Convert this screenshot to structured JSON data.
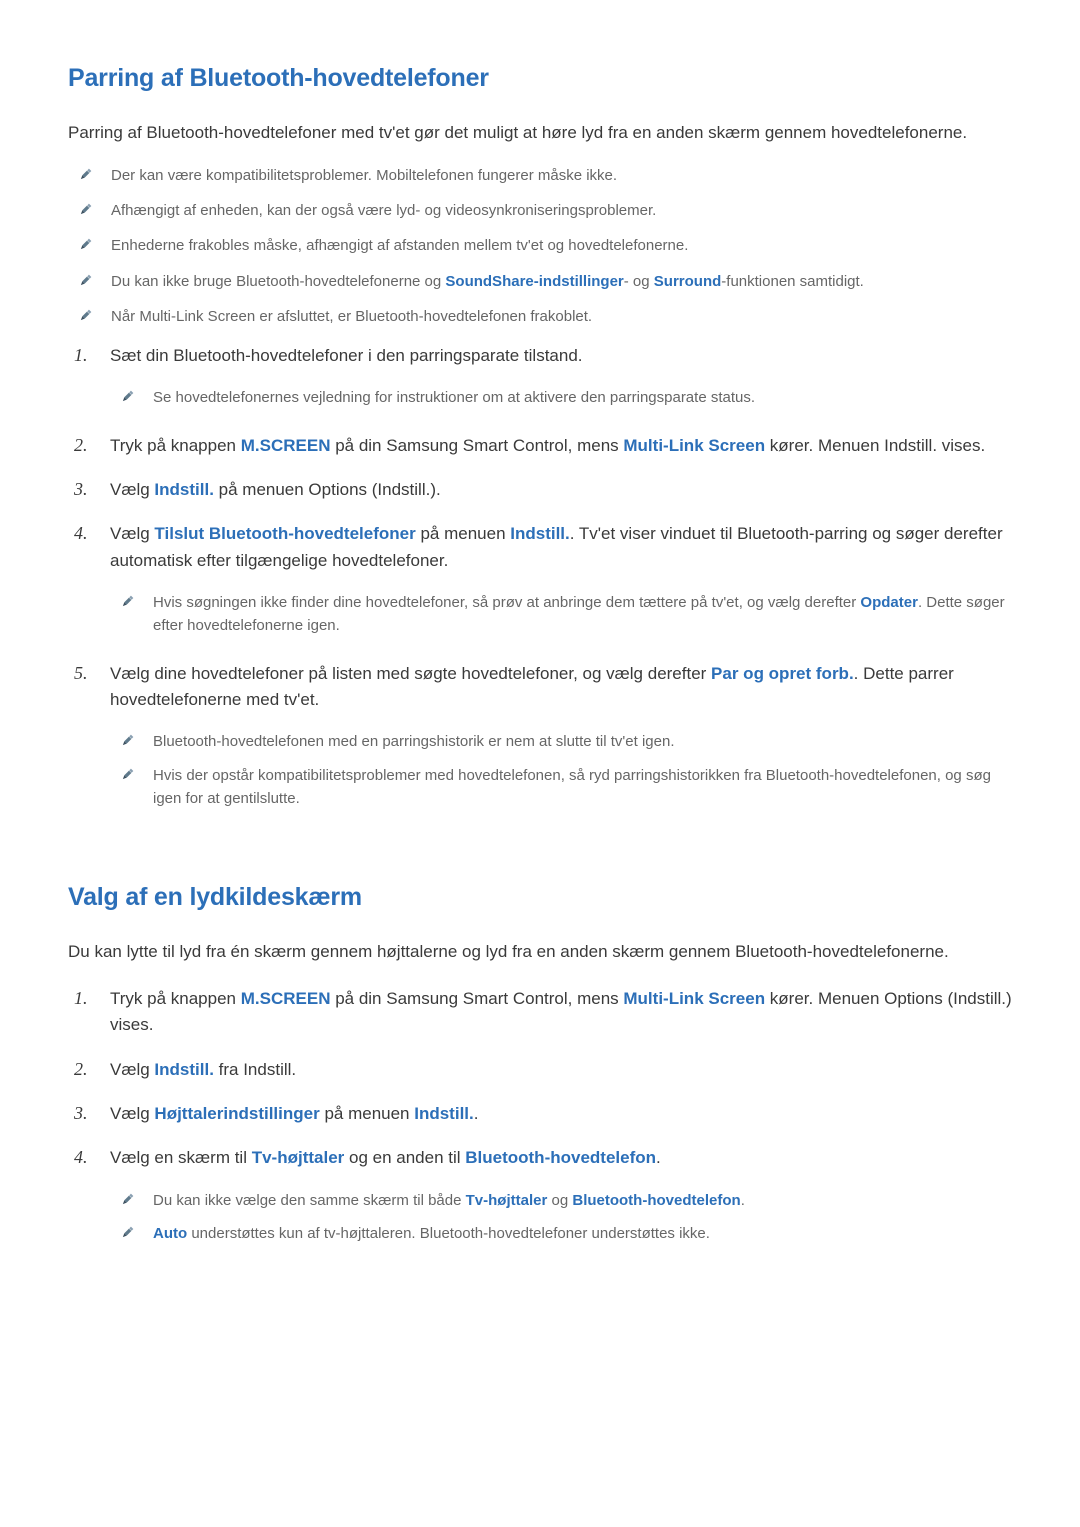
{
  "section1": {
    "title": "Parring af Bluetooth-hovedtelefoner",
    "intro": "Parring af Bluetooth-hovedtelefoner med tv'et gør det muligt at høre lyd fra en anden skærm gennem hovedtelefonerne.",
    "notes": [
      {
        "text": "Der kan være kompatibilitetsproblemer. Mobiltelefonen fungerer måske ikke."
      },
      {
        "text": "Afhængigt af enheden, kan der også være lyd- og videosynkroniseringsproblemer."
      },
      {
        "text": "Enhederne frakobles måske, afhængigt af afstanden mellem tv'et og hovedtelefonerne."
      },
      {
        "pre": "Du kan ikke bruge Bluetooth-hovedtelefonerne og ",
        "kw1": "SoundShare-indstillinger",
        "mid": "- og ",
        "kw2": "Surround",
        "post": "-funktionen samtidigt."
      },
      {
        "text": "Når Multi-Link Screen er afsluttet, er Bluetooth-hovedtelefonen frakoblet."
      }
    ],
    "steps": [
      {
        "num": "1.",
        "text": "Sæt din Bluetooth-hovedtelefoner i den parringsparate tilstand.",
        "subnotes": [
          {
            "text": "Se hovedtelefonernes vejledning for instruktioner om at aktivere den parringsparate status."
          }
        ]
      },
      {
        "num": "2.",
        "pre": "Tryk på knappen ",
        "kw1": "M.SCREEN",
        "mid": " på din Samsung Smart Control, mens ",
        "kw2": "Multi-Link Screen",
        "post": " kører. Menuen Indstill. vises."
      },
      {
        "num": "3.",
        "pre": "Vælg ",
        "kw1": "Indstill.",
        "post": " på menuen Options (Indstill.)."
      },
      {
        "num": "4.",
        "pre": "Vælg ",
        "kw1": "Tilslut Bluetooth-hovedtelefoner",
        "mid": " på menuen ",
        "kw2": "Indstill.",
        "post": ". Tv'et viser vinduet til Bluetooth-parring og søger derefter automatisk efter tilgængelige hovedtelefoner.",
        "subnotes": [
          {
            "pre": "Hvis søgningen ikke finder dine hovedtelefoner, så prøv at anbringe dem tættere på tv'et, og vælg derefter ",
            "kw1": "Opdater",
            "post": ". Dette søger efter hovedtelefonerne igen."
          }
        ]
      },
      {
        "num": "5.",
        "pre": "Vælg dine hovedtelefoner på listen med søgte hovedtelefoner, og vælg derefter ",
        "kw1": "Par og opret forb.",
        "post": ". Dette parrer hovedtelefonerne med tv'et.",
        "subnotes": [
          {
            "text": "Bluetooth-hovedtelefonen med en parringshistorik er nem at slutte til tv'et igen."
          },
          {
            "text": "Hvis der opstår kompatibilitetsproblemer med hovedtelefonen, så ryd parringshistorikken fra Bluetooth-hovedtelefonen, og søg igen for at gentilslutte."
          }
        ]
      }
    ]
  },
  "section2": {
    "title": "Valg af en lydkildeskærm",
    "intro": "Du kan lytte til lyd fra én skærm gennem højttalerne og lyd fra en anden skærm gennem Bluetooth-hovedtelefonerne.",
    "steps": [
      {
        "num": "1.",
        "pre": "Tryk på knappen ",
        "kw1": "M.SCREEN",
        "mid": " på din Samsung Smart Control, mens ",
        "kw2": "Multi-Link Screen",
        "post": " kører. Menuen Options (Indstill.) vises."
      },
      {
        "num": "2.",
        "pre": "Vælg ",
        "kw1": "Indstill.",
        "post": " fra Indstill."
      },
      {
        "num": "3.",
        "pre": "Vælg ",
        "kw1": "Højttalerindstillinger",
        "mid": " på menuen ",
        "kw2": "Indstill.",
        "post": "."
      },
      {
        "num": "4.",
        "pre": "Vælg en skærm til ",
        "kw1": "Tv-højttaler",
        "mid": " og en anden til ",
        "kw2": "Bluetooth-hovedtelefon",
        "post": ".",
        "subnotes": [
          {
            "pre": "Du kan ikke vælge den samme skærm til både ",
            "kw1": "Tv-højttaler",
            "mid": " og ",
            "kw2": "Bluetooth-hovedtelefon",
            "post": "."
          },
          {
            "kw1": "Auto",
            "post": " understøttes kun af tv-højttaleren. Bluetooth-hovedtelefoner understøttes ikke."
          }
        ]
      }
    ]
  }
}
